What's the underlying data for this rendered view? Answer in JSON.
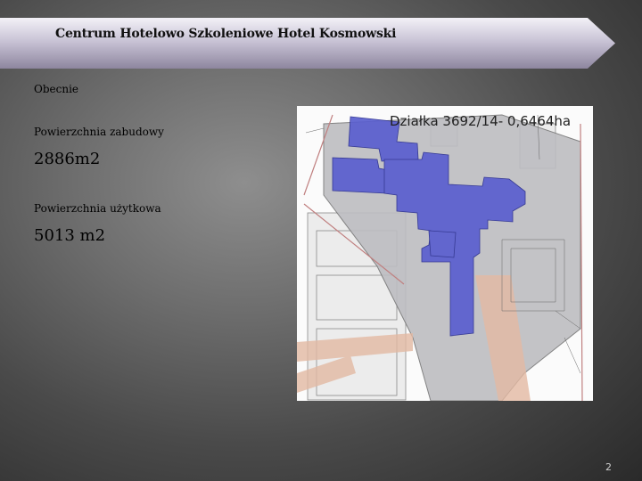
{
  "slide": {
    "title": "Centrum Hotelowo Szkoleniowe Hotel Kosmowski",
    "section_label": "Obecnie",
    "built_area_label": "Powierzchnia zabudowy",
    "built_area_value": "2886m2",
    "usable_area_label": "Powierzchnia użytkowa",
    "usable_area_value": "5013  m2",
    "page_number": "2"
  },
  "map": {
    "caption": "Działka 3692/14- 0,6464ha",
    "colors": {
      "building": "#5a5fcf",
      "parcel": "#b9b9bd",
      "road": "#e3b9a3",
      "boundary": "#c08080"
    }
  }
}
